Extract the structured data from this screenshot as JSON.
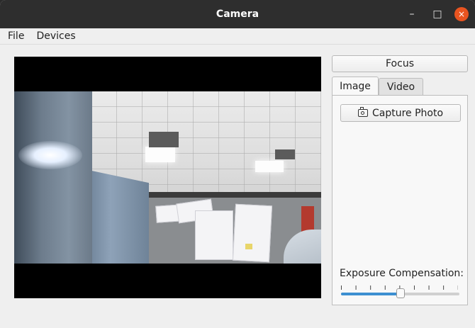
{
  "window": {
    "title": "Camera",
    "minimize_glyph": "–",
    "maximize_glyph": "□",
    "close_glyph": "×"
  },
  "menu": {
    "items": [
      "File",
      "Devices"
    ]
  },
  "controls": {
    "focus_label": "Focus",
    "tabs": [
      {
        "label": "Image",
        "selected": true
      },
      {
        "label": "Video",
        "selected": false
      }
    ],
    "capture_label": "Capture Photo",
    "capture_icon": "camera-icon",
    "exposure_label": "Exposure Compensation:",
    "exposure_value_fraction": 0.5
  },
  "colors": {
    "close_button": "#e95420",
    "slider_fill": "#3d8fd1"
  }
}
